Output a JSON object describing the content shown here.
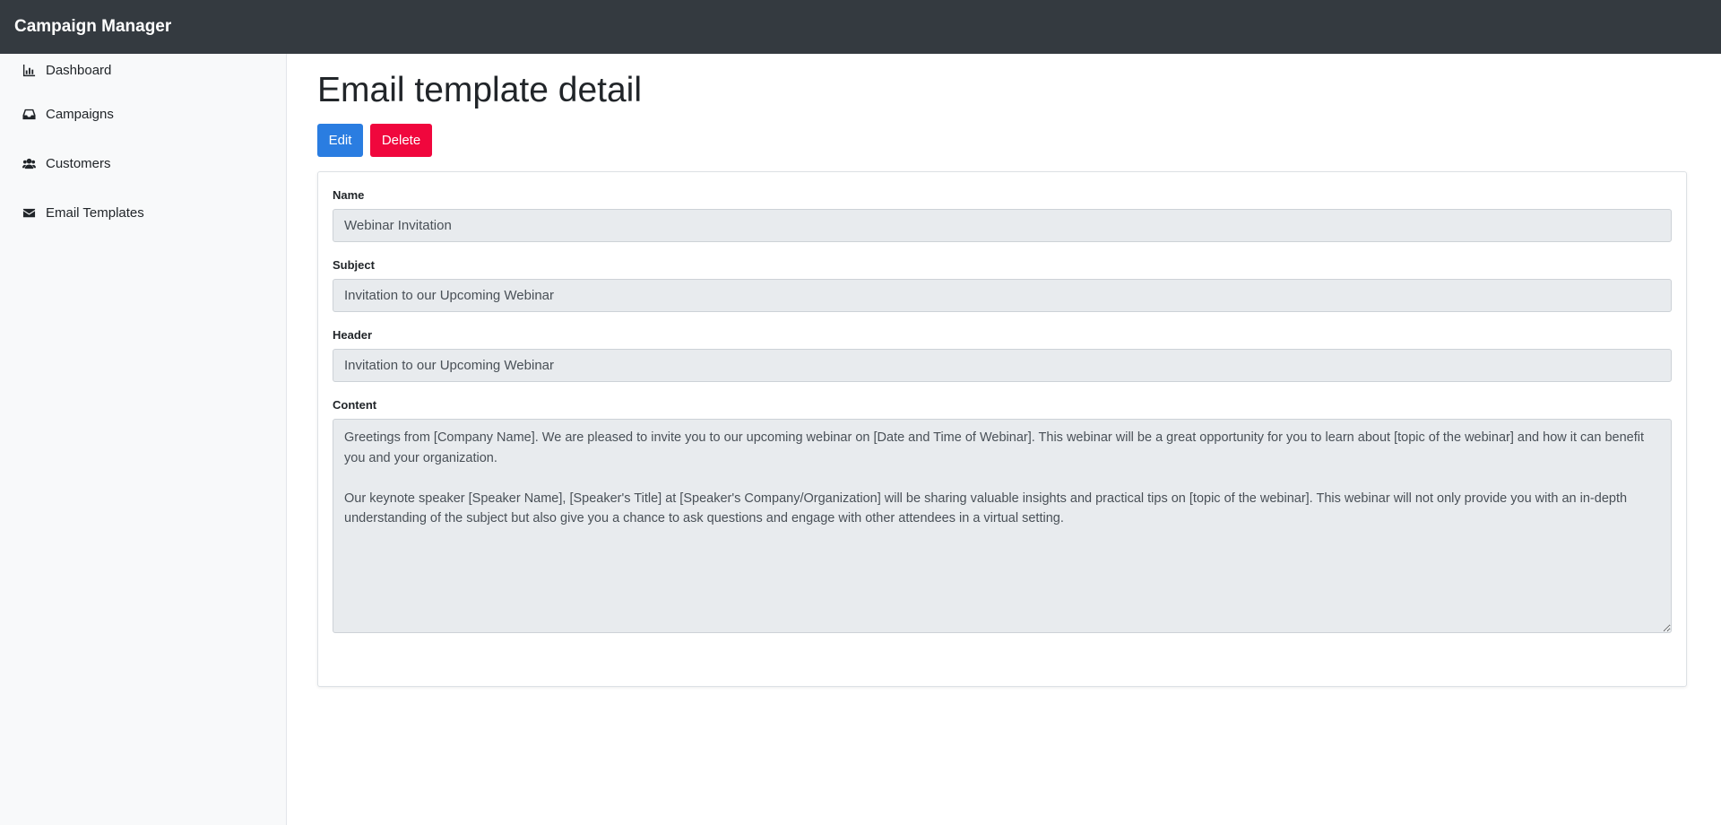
{
  "app": {
    "title": "Campaign Manager"
  },
  "sidebar": {
    "items": [
      {
        "label": "Dashboard",
        "icon": "chart-icon"
      },
      {
        "label": "Campaigns",
        "icon": "inbox-icon"
      },
      {
        "label": "Customers",
        "icon": "users-icon"
      },
      {
        "label": "Email Templates",
        "icon": "envelope-icon"
      }
    ]
  },
  "page": {
    "title": "Email template detail",
    "edit_label": "Edit",
    "delete_label": "Delete"
  },
  "form": {
    "name_label": "Name",
    "name_value": "Webinar Invitation",
    "subject_label": "Subject",
    "subject_value": "Invitation to our Upcoming Webinar",
    "header_label": "Header",
    "header_value": "Invitation to our Upcoming Webinar",
    "content_label": "Content",
    "content_value": "Greetings from [Company Name]. We are pleased to invite you to our upcoming webinar on [Date and Time of Webinar]. This webinar will be a great opportunity for you to learn about [topic of the webinar] and how it can benefit you and your organization.\n\nOur keynote speaker [Speaker Name], [Speaker's Title] at [Speaker's Company/Organization] will be sharing valuable insights and practical tips on [topic of the webinar]. This webinar will not only provide you with an in-depth understanding of the subject but also give you a chance to ask questions and engage with other attendees in a virtual setting."
  },
  "colors": {
    "topbar": "#343a40",
    "sidebar": "#f8f9fa",
    "edit_button": "#2a7de1",
    "delete_button": "#f0073d",
    "readonly_field": "#e8ebee"
  }
}
